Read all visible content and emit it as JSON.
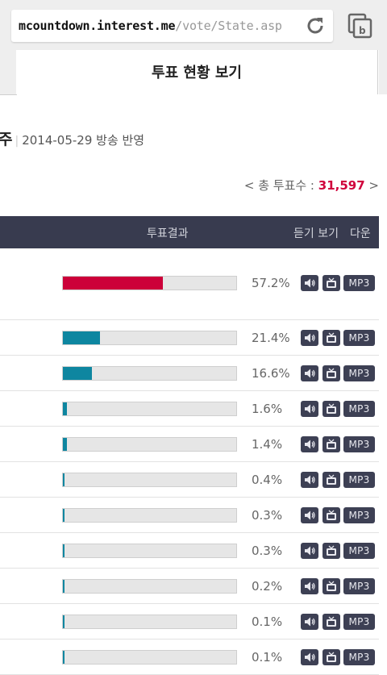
{
  "browser": {
    "url_domain": "mcountdown.interest.me",
    "url_path": "/vote/State.asp"
  },
  "page": {
    "tab_label": "투표 현황 보기",
    "date_char": "주",
    "date_text": "2014-05-29 방송 반영",
    "total_prefix": "< 총 투표수 : ",
    "total_value": "31,597",
    "total_suffix": " >"
  },
  "table": {
    "header": {
      "result": "투표결과",
      "listen": "듣기 보기",
      "download": "다운"
    },
    "mp3_label": "MP3",
    "rows": [
      {
        "percent": "57.2%",
        "value": 57.2,
        "color": "#cc0039"
      },
      {
        "percent": "21.4%",
        "value": 21.4,
        "color": "#0e86a0"
      },
      {
        "percent": "16.6%",
        "value": 16.6,
        "color": "#0e86a0"
      },
      {
        "percent": "1.6%",
        "value": 1.6,
        "color": "#0e86a0"
      },
      {
        "percent": "1.4%",
        "value": 1.4,
        "color": "#0e86a0"
      },
      {
        "percent": "0.4%",
        "value": 0.4,
        "color": "#0e86a0"
      },
      {
        "percent": "0.3%",
        "value": 0.3,
        "color": "#0e86a0"
      },
      {
        "percent": "0.3%",
        "value": 0.3,
        "color": "#0e86a0"
      },
      {
        "percent": "0.2%",
        "value": 0.2,
        "color": "#0e86a0"
      },
      {
        "percent": "0.1%",
        "value": 0.1,
        "color": "#0e86a0"
      },
      {
        "percent": "0.1%",
        "value": 0.1,
        "color": "#0e86a0"
      }
    ]
  },
  "icons": {
    "reload": "reload-icon",
    "tabs": "tabs-icon",
    "sound": "speaker-icon",
    "tv": "tv-icon"
  }
}
